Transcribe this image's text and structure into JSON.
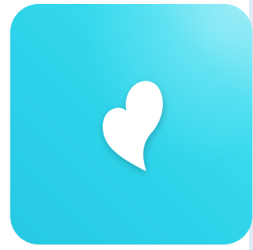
{
  "app_icon": {
    "icon": "heart-icon",
    "colors": {
      "background_top_right": "#86e6f5",
      "background_main": "#2dd3ea",
      "background_bottom_left": "#25c9e2",
      "glyph": "#ffffff",
      "page_background": "#ffffff",
      "edge_strip": "#dfe9f3"
    }
  }
}
